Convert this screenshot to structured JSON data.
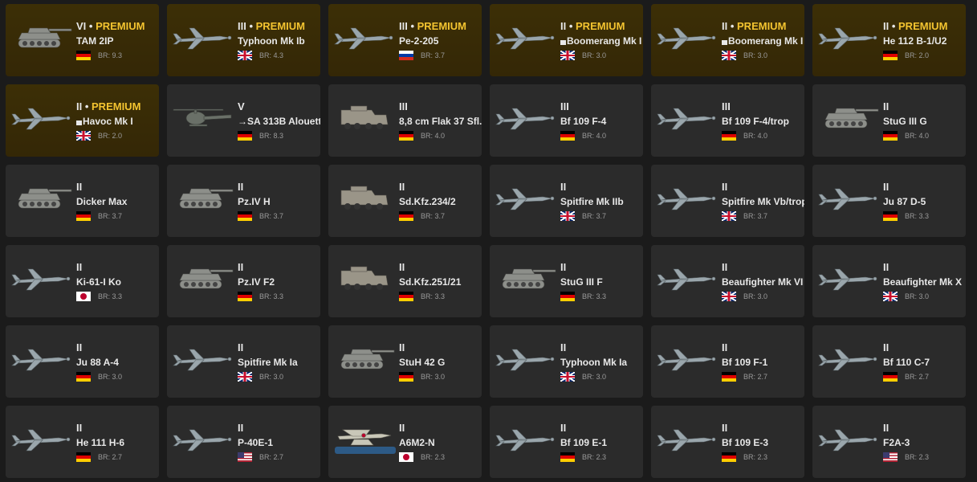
{
  "premium_label": "PREMIUM",
  "br_prefix": "BR:",
  "vehicles": [
    {
      "tier": "VI",
      "premium": true,
      "name": "TAM 2IP",
      "flag": "de",
      "br": "9.3",
      "type": "tank"
    },
    {
      "tier": "III",
      "premium": true,
      "name": "Typhoon Mk Ib",
      "flag": "gb",
      "br": "4.3",
      "type": "plane"
    },
    {
      "tier": "III",
      "premium": true,
      "name": "Pe-2-205",
      "flag": "ru",
      "br": "3.7",
      "type": "plane"
    },
    {
      "tier": "II",
      "premium": true,
      "name": "Boomerang Mk I",
      "pkg": true,
      "flag": "gb",
      "br": "3.0",
      "type": "plane"
    },
    {
      "tier": "II",
      "premium": true,
      "name": "Boomerang Mk I",
      "pkg": true,
      "flag": "gb",
      "br": "3.0",
      "type": "plane"
    },
    {
      "tier": "II",
      "premium": true,
      "name": "He 112 B-1/U2",
      "flag": "de",
      "br": "2.0",
      "type": "plane"
    },
    {
      "tier": "II",
      "premium": true,
      "name": "Havoc Mk I",
      "pkg": true,
      "flag": "gb",
      "br": "2.0",
      "type": "plane"
    },
    {
      "tier": "V",
      "premium": false,
      "name": "→SA 313B Alouette",
      "flag": "de",
      "br": "8.3",
      "type": "heli"
    },
    {
      "tier": "III",
      "premium": false,
      "name": "8,8 cm Flak 37 Sfl.",
      "flag": "de",
      "br": "4.0",
      "type": "truck"
    },
    {
      "tier": "III",
      "premium": false,
      "name": "Bf 109 F-4",
      "flag": "de",
      "br": "4.0",
      "type": "plane"
    },
    {
      "tier": "III",
      "premium": false,
      "name": "Bf 109 F-4/trop",
      "flag": "de",
      "br": "4.0",
      "type": "plane"
    },
    {
      "tier": "II",
      "premium": false,
      "name": "StuG III G",
      "flag": "de",
      "br": "4.0",
      "type": "tank"
    },
    {
      "tier": "II",
      "premium": false,
      "name": "Dicker Max",
      "flag": "de",
      "br": "3.7",
      "type": "tank"
    },
    {
      "tier": "II",
      "premium": false,
      "name": "Pz.IV H",
      "flag": "de",
      "br": "3.7",
      "type": "tank"
    },
    {
      "tier": "II",
      "premium": false,
      "name": "Sd.Kfz.234/2",
      "flag": "de",
      "br": "3.7",
      "type": "truck"
    },
    {
      "tier": "II",
      "premium": false,
      "name": "Spitfire Mk IIb",
      "flag": "gb",
      "br": "3.7",
      "type": "plane"
    },
    {
      "tier": "II",
      "premium": false,
      "name": "Spitfire Mk Vb/trop",
      "flag": "gb",
      "br": "3.7",
      "type": "plane"
    },
    {
      "tier": "II",
      "premium": false,
      "name": "Ju 87 D-5",
      "flag": "de",
      "br": "3.3",
      "type": "plane"
    },
    {
      "tier": "II",
      "premium": false,
      "name": "Ki-61-I Ko",
      "flag": "jp",
      "br": "3.3",
      "type": "plane"
    },
    {
      "tier": "II",
      "premium": false,
      "name": "Pz.IV F2",
      "flag": "de",
      "br": "3.3",
      "type": "tank"
    },
    {
      "tier": "II",
      "premium": false,
      "name": "Sd.Kfz.251/21",
      "flag": "de",
      "br": "3.3",
      "type": "truck"
    },
    {
      "tier": "II",
      "premium": false,
      "name": "StuG III F",
      "flag": "de",
      "br": "3.3",
      "type": "tank"
    },
    {
      "tier": "II",
      "premium": false,
      "name": "Beaufighter Mk VI",
      "flag": "gb",
      "br": "3.0",
      "type": "plane"
    },
    {
      "tier": "II",
      "premium": false,
      "name": "Beaufighter Mk X",
      "flag": "gb",
      "br": "3.0",
      "type": "plane"
    },
    {
      "tier": "II",
      "premium": false,
      "name": "Ju 88 A-4",
      "flag": "de",
      "br": "3.0",
      "type": "plane"
    },
    {
      "tier": "II",
      "premium": false,
      "name": "Spitfire Mk Ia",
      "flag": "gb",
      "br": "3.0",
      "type": "plane"
    },
    {
      "tier": "II",
      "premium": false,
      "name": "StuH 42 G",
      "flag": "de",
      "br": "3.0",
      "type": "tank"
    },
    {
      "tier": "II",
      "premium": false,
      "name": "Typhoon Mk Ia",
      "flag": "gb",
      "br": "3.0",
      "type": "plane"
    },
    {
      "tier": "II",
      "premium": false,
      "name": "Bf 109 F-1",
      "flag": "de",
      "br": "2.7",
      "type": "plane"
    },
    {
      "tier": "II",
      "premium": false,
      "name": "Bf 110 C-7",
      "flag": "de",
      "br": "2.7",
      "type": "plane"
    },
    {
      "tier": "II",
      "premium": false,
      "name": "He 111 H-6",
      "flag": "de",
      "br": "2.7",
      "type": "plane"
    },
    {
      "tier": "II",
      "premium": false,
      "name": "P-40E-1",
      "flag": "us",
      "br": "2.7",
      "type": "plane"
    },
    {
      "tier": "II",
      "premium": false,
      "name": "A6M2-N",
      "flag": "jp",
      "br": "2.3",
      "type": "seaplane"
    },
    {
      "tier": "II",
      "premium": false,
      "name": "Bf 109 E-1",
      "flag": "de",
      "br": "2.3",
      "type": "plane"
    },
    {
      "tier": "II",
      "premium": false,
      "name": "Bf 109 E-3",
      "flag": "de",
      "br": "2.3",
      "type": "plane"
    },
    {
      "tier": "II",
      "premium": false,
      "name": "F2A-3",
      "flag": "us",
      "br": "2.3",
      "type": "plane"
    }
  ]
}
